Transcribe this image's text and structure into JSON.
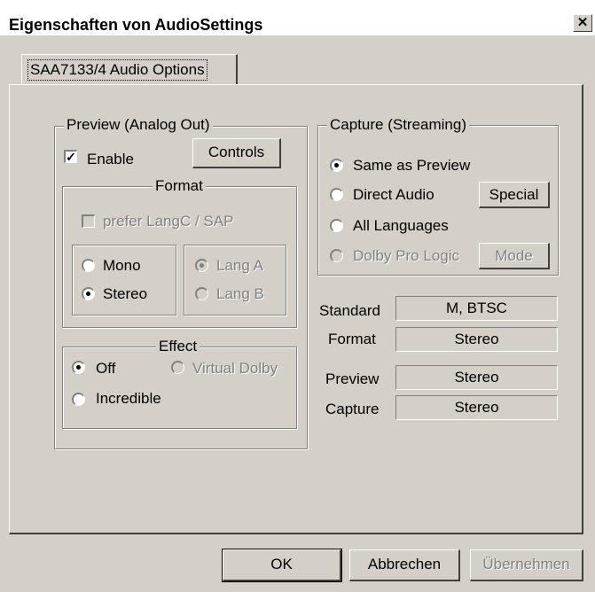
{
  "window": {
    "title": "Eigenschaften von AudioSettings",
    "close_glyph": "✕"
  },
  "tab": {
    "label": "SAA7133/4 Audio Options"
  },
  "preview": {
    "group_title": "Preview (Analog Out)",
    "enable_label": "Enable",
    "enable_checked": true,
    "controls_button": "Controls",
    "format": {
      "group_title": "Format",
      "prefer_langc_label": "prefer LangC / SAP",
      "mono_label": "Mono",
      "stereo_label": "Stereo",
      "selected_channel": "Stereo",
      "lang_a_label": "Lang A",
      "lang_b_label": "Lang B",
      "selected_lang": "Lang A"
    },
    "effect": {
      "group_title": "Effect",
      "off_label": "Off",
      "virtual_dolby_label": "Virtual Dolby",
      "incredible_label": "Incredible",
      "selected": "Off"
    }
  },
  "capture": {
    "group_title": "Capture (Streaming)",
    "same_as_preview_label": "Same as Preview",
    "direct_audio_label": "Direct Audio",
    "special_button": "Special",
    "all_languages_label": "All Languages",
    "dolby_pro_logic_label": "Dolby Pro Logic",
    "mode_button": "Mode",
    "selected": "Same as Preview"
  },
  "info": {
    "standard_label": "Standard",
    "standard_value": "M, BTSC",
    "format_label": "Format",
    "format_value": "Stereo",
    "preview_label": "Preview",
    "preview_value": "Stereo",
    "capture_label": "Capture",
    "capture_value": "Stereo"
  },
  "footer": {
    "ok_button": "OK",
    "cancel_button": "Abbrechen",
    "apply_button": "Übernehmen"
  },
  "colors": {
    "face": "#d4d0c8",
    "shadow": "#808080",
    "dark": "#404040",
    "highlight": "#ffffff"
  }
}
